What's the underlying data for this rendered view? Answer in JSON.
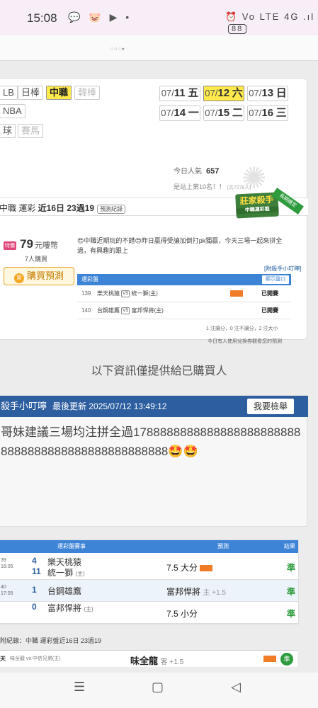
{
  "status": {
    "time": "15:08",
    "left_icons": "💬 🐷 ▶ •",
    "right_icons": "⏰ Vo LTE 4G .ıl",
    "battery": "88"
  },
  "leagues": [
    "LB",
    "日棒",
    "中職",
    "韓棒",
    "NBA",
    "球",
    "賽馬"
  ],
  "dates": [
    {
      "md": "07/",
      "day": "11",
      "wd": "五"
    },
    {
      "md": "07/",
      "day": "12",
      "wd": "六"
    },
    {
      "md": "07/",
      "day": "13",
      "wd": "日"
    },
    {
      "md": "07/",
      "day": "14",
      "wd": "一"
    },
    {
      "md": "07/",
      "day": "15",
      "wd": "二"
    },
    {
      "md": "07/",
      "day": "16",
      "wd": "三"
    }
  ],
  "popularity": {
    "label": "今日人氣",
    "value": "657",
    "rank": "是站上第10名！！",
    "rank_small": "(共7278人)"
  },
  "title": {
    "prefix": "中職 運彩 ",
    "bold": "近16日 23過19",
    "record_btn": "預測紀錄"
  },
  "badge": {
    "main": "莊家殺手",
    "sub": "中職運彩盤",
    "ribbon": "長期穩定"
  },
  "price": {
    "tag": "特價",
    "value": "79",
    "unit": "元嘍幣",
    "buyers": "7人購買",
    "buy_label": "購買預測",
    "buy_icon": "搶"
  },
  "comment": "😍中職近期玩的不錯😍昨日贏得受讓加倒打pk獨贏，今天三場一起來拼全過，有興趣的跟上",
  "hint_link": "[附殺手小叮嚀]",
  "mini": {
    "head": "運彩盤",
    "more": "顯示盤口",
    "rows": [
      {
        "no": "139",
        "away": "樂天桃猿",
        "vs": "VS",
        "home": "統一獅(主)",
        "status": "已開賽"
      },
      {
        "no": "140",
        "away": "台鋼雄鷹",
        "vs": "VS",
        "home": "富邦悍將(主)",
        "status": "已開賽"
      }
    ],
    "note1": "1 注讓分，0 注不讓分，2 注大小",
    "note2": "今日有人使用兌換券觀看您的預測"
  },
  "info_line": "以下資訊僅提供給已購買人",
  "hint": {
    "title": "殺手小叮嚀",
    "updated": "最後更新 2025/07/12 13:49:12",
    "report": "我要檢舉",
    "text": "哥妹建議三場均注拼全過17888888888888888888888888888888888888888888888888🤩🤩"
  },
  "table": {
    "headers": [
      "運彩盤賽事",
      "預測",
      "結果"
    ],
    "games": [
      {
        "gid": "39",
        "time": "16:05",
        "away_score": "4",
        "away": "樂天桃猿",
        "home_score": "11",
        "home": "統一獅",
        "preds": [
          {
            "pick": "7.5 大分",
            "extra": "",
            "result": "準"
          }
        ]
      },
      {
        "gid": "40",
        "time": "17:05",
        "away_score": "1",
        "away": "台鋼雄鷹",
        "home_score": "0",
        "home": "富邦悍將",
        "preds": [
          {
            "pick": "富邦悍將",
            "extra": "主 +1.5",
            "result": "準"
          },
          {
            "pick": "7.5 小分",
            "extra": "",
            "result": "準"
          }
        ]
      }
    ]
  },
  "history": {
    "label": "附紀錄：中職 運彩盤近16日 23過19",
    "row": {
      "mon": "天",
      "sub": "味全龍 vs 中信兄弟(主)",
      "pick": "味全龍",
      "pick_extra": "客 +1.5",
      "result": "準"
    }
  },
  "colors": {
    "accent": "#3e84d6",
    "hint_head": "#2c5ea0",
    "win": "#2e9b3d",
    "active_yellow": "#ffe94b"
  }
}
